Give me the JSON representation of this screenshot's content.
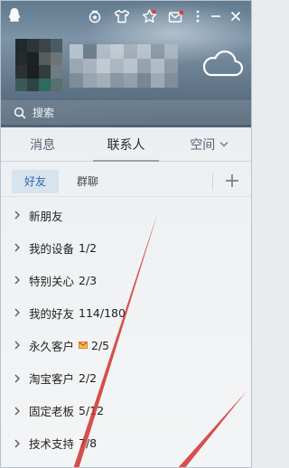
{
  "search": {
    "placeholder": "搜索"
  },
  "tabs": [
    {
      "label": "消息"
    },
    {
      "label": "联系人"
    },
    {
      "label": "空间"
    }
  ],
  "subtabs": [
    {
      "label": "好友"
    },
    {
      "label": "群聊"
    }
  ],
  "add_label": "+",
  "groups": [
    {
      "name": "新朋友",
      "count": ""
    },
    {
      "name": "我的设备",
      "count": "1/2"
    },
    {
      "name": "特别关心",
      "count": "2/3"
    },
    {
      "name": "我的好友",
      "count": "114/180"
    },
    {
      "name": "永久客户",
      "count": "2/5"
    },
    {
      "name": "淘宝客户",
      "count": "2/2"
    },
    {
      "name": "固定老板",
      "count": "5/12"
    },
    {
      "name": "技术支持",
      "count": "7/8"
    }
  ],
  "colors": {
    "accent": "#2a6bb0",
    "subtab_active_bg": "#d7e3ee",
    "header_sky": "#617a8e",
    "streak": "#d0312d"
  },
  "icons": {
    "titlebar": [
      "qzone-star-badge-icon",
      "tshirt-icon",
      "star-icon",
      "mail-icon",
      "more-icon",
      "minimize-icon",
      "close-icon"
    ],
    "weather": "cloud-icon",
    "search": "search-icon",
    "group_arrow": "chevron-right-icon",
    "mail_badge": "envelope-icon"
  }
}
